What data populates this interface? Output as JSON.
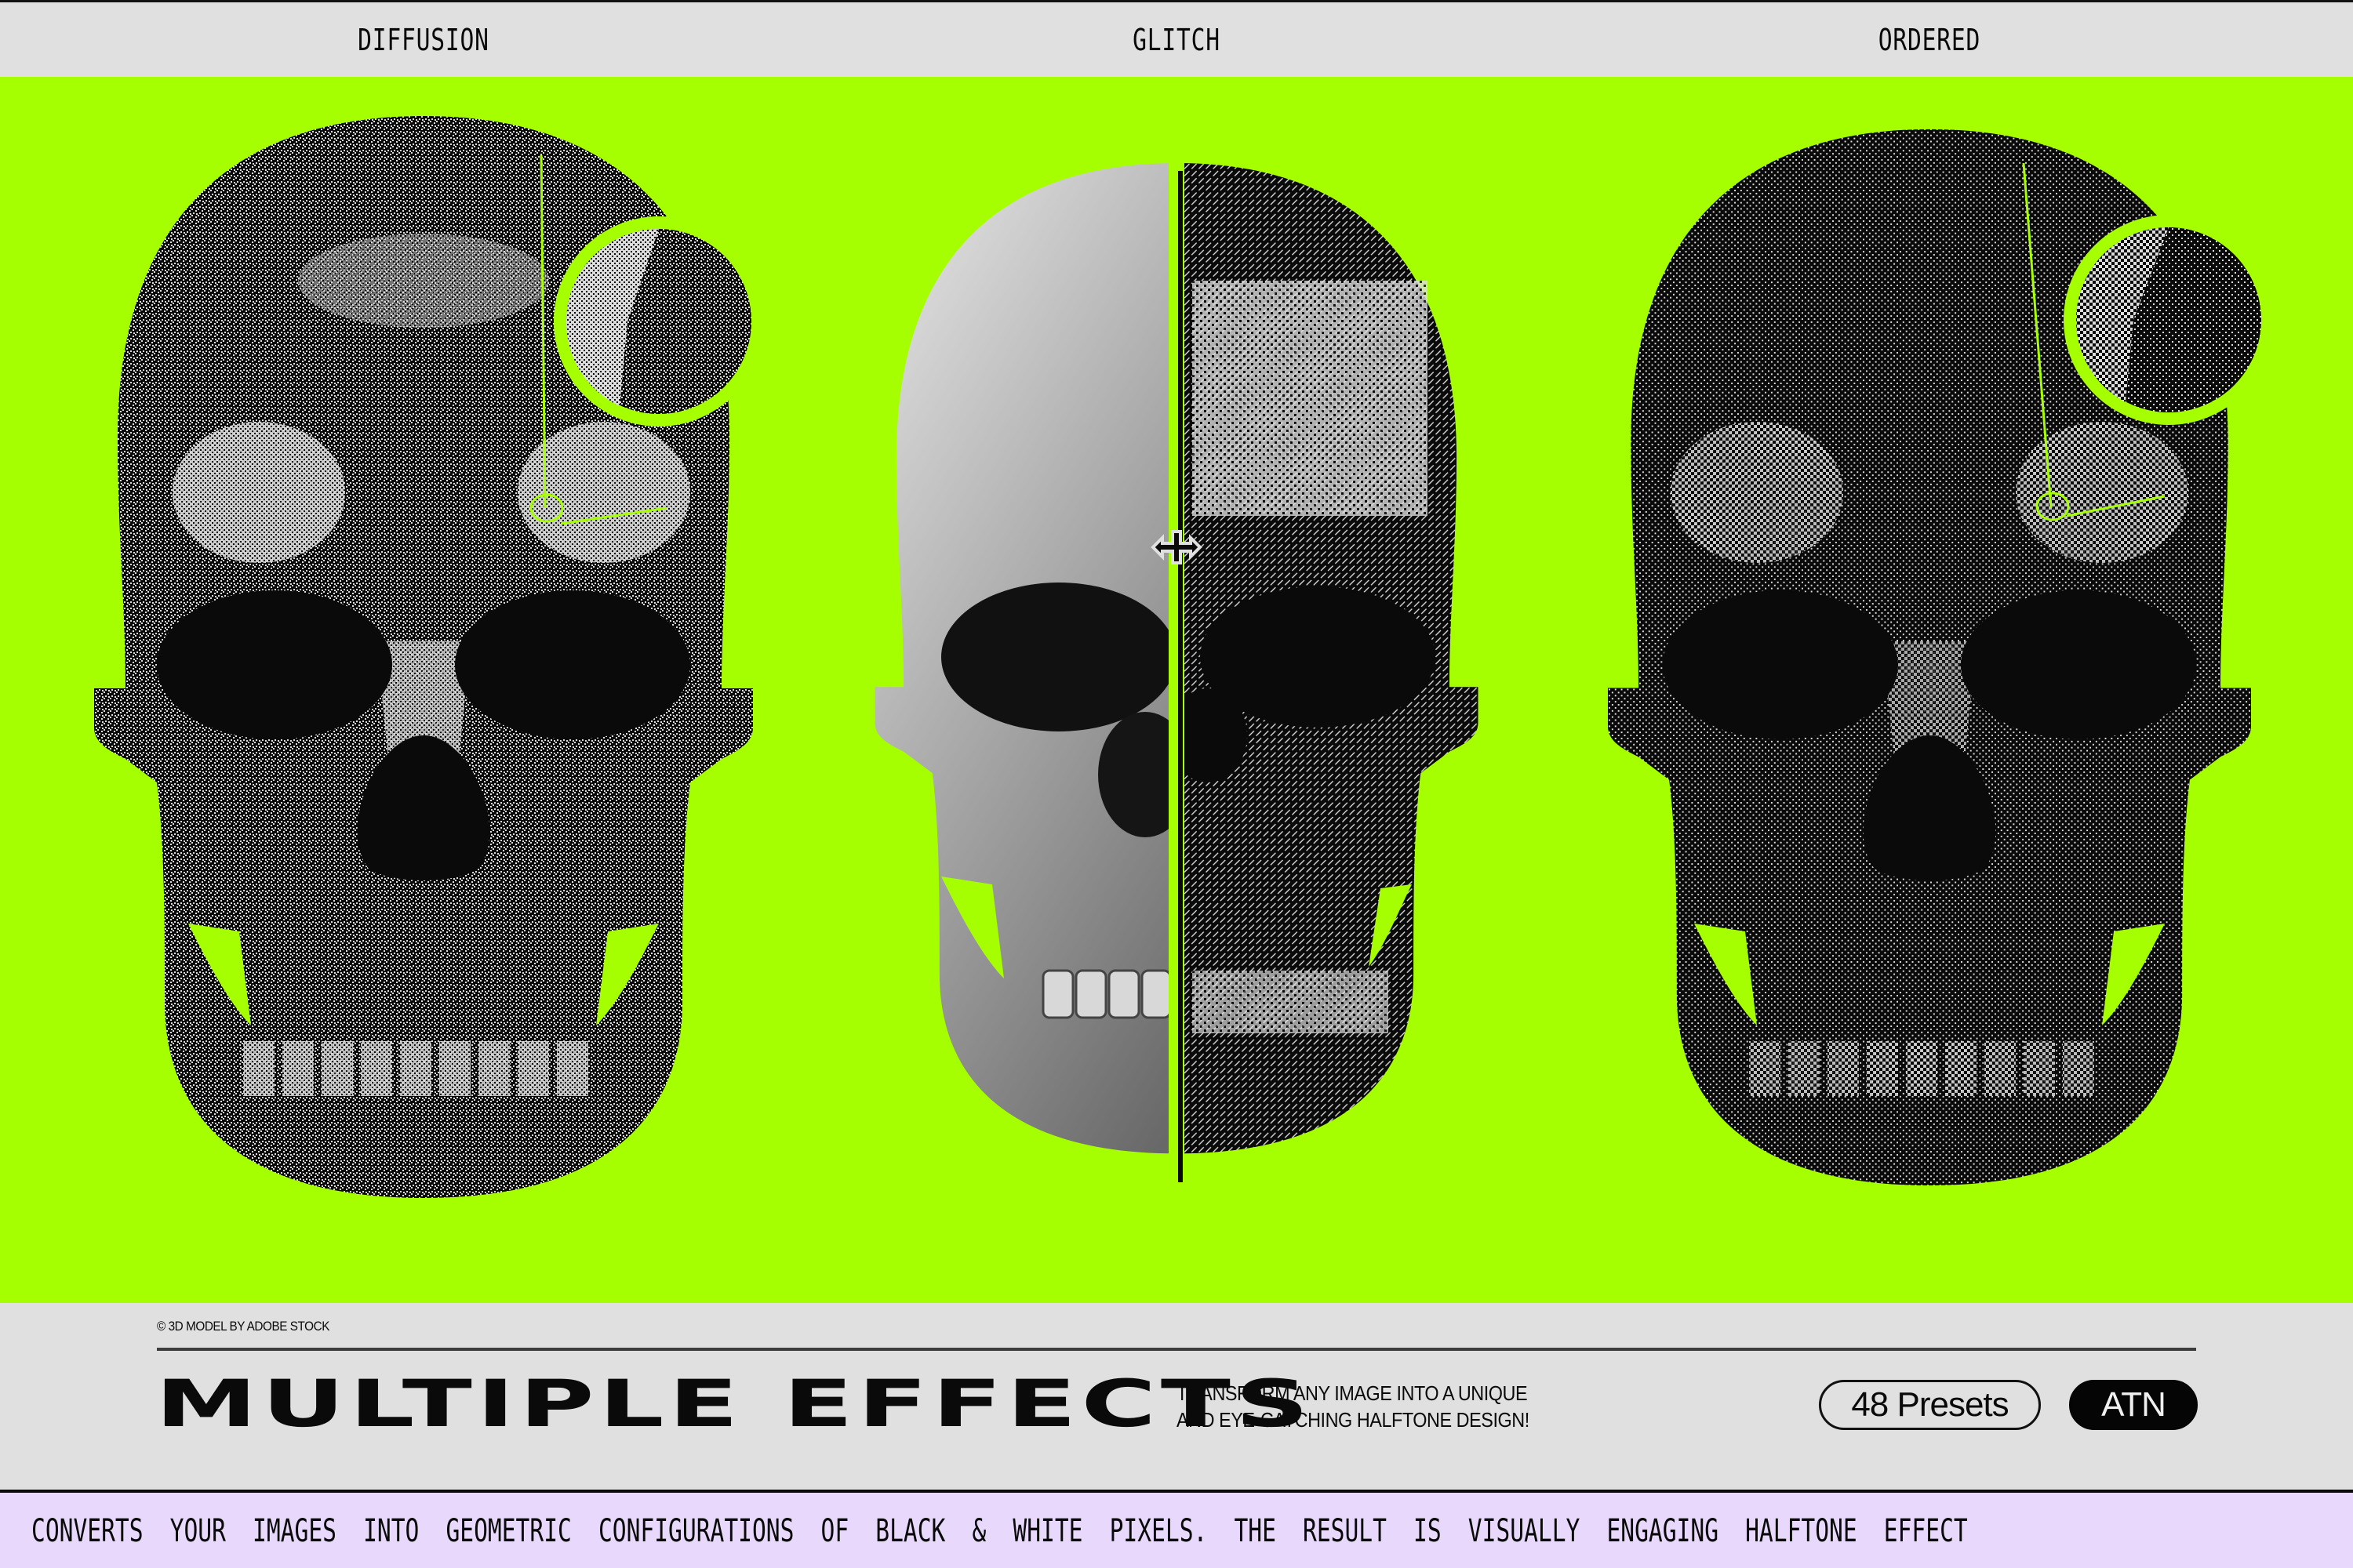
{
  "colors": {
    "accent_green": "#a6ff00",
    "panel_gray": "#e0e0e0",
    "ticker_lavender": "#e8d9fc",
    "ink": "#0a0a0a"
  },
  "panels": [
    {
      "label": "DIFFUSION",
      "effect": "diffusion-dither",
      "has_magnifier": true
    },
    {
      "label": "GLITCH",
      "effect": "split-original-vs-glitch",
      "has_magnifier": false
    },
    {
      "label": "ORDERED",
      "effect": "ordered-dither",
      "has_magnifier": true
    }
  ],
  "comparison_handle": {
    "icon": "move-horizontal-cursor-icon"
  },
  "info": {
    "credit": "© 3D MODEL BY ADOBE STOCK",
    "title": "MULTIPLE EFFECTS",
    "description_line1": "TRANSFORM ANY IMAGE INTO A UNIQUE",
    "description_line2": "AND EYE-CATCHING HALFTONE DESIGN!",
    "presets_badge": "48 Presets",
    "format_badge": "ATN"
  },
  "ticker": {
    "text": "CONVERTS YOUR IMAGES INTO GEOMETRIC CONFIGURATIONS OF BLACK & WHITE PIXELS. THE RESULT IS VISUALLY ENGAGING HALFTONE EFFECT"
  }
}
